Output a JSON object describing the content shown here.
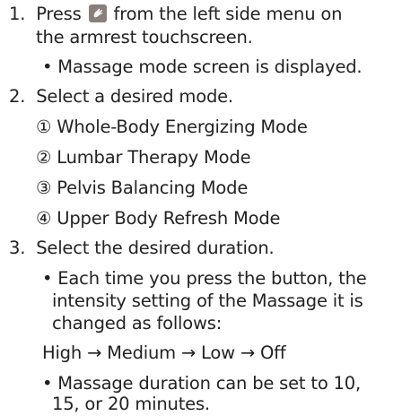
{
  "steps": [
    {
      "number": "1.",
      "line1_before": "Press",
      "line1_after": "from the left side menu on",
      "line2": "the armrest touchscreen.",
      "icon": "massage-icon",
      "bullet": "• Massage mode screen is displayed."
    },
    {
      "number": "2.",
      "text": "Select a desired mode.",
      "modes": [
        "① Whole-Body Energizing Mode",
        "② Lumbar Therapy Mode",
        "③ Pelvis Balancing Mode",
        "④ Upper Body Refresh Mode"
      ]
    },
    {
      "number": "3.",
      "text": "Select the desired duration.",
      "bullet1_line1": "•  Each time you press the button, the",
      "bullet1_line2": "intensity setting of the Massage it is",
      "bullet1_line3": "changed as follows:",
      "sequence": "High → Medium → Low → Off",
      "bullet2_line1": "• Massage duration can be set to 10,",
      "bullet2_line2": "15, or 20 minutes."
    }
  ],
  "colors": {
    "text": "#222222",
    "icon_bg": "#8a7e7a"
  }
}
